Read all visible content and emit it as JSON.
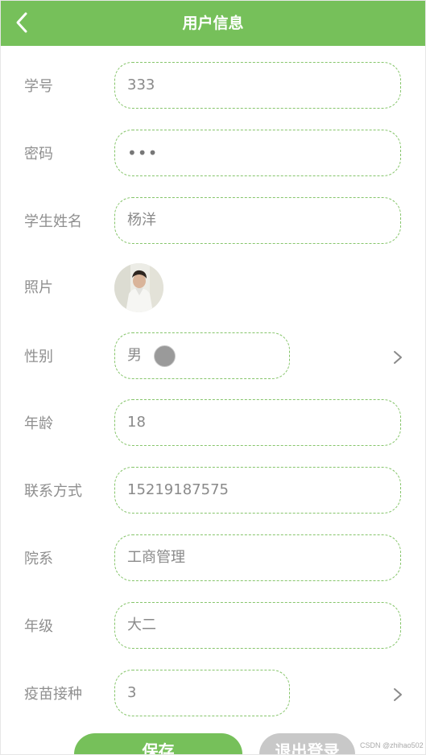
{
  "header": {
    "title": "用户信息",
    "back_icon": "chevron-left-icon",
    "background": "#76c05a"
  },
  "form": {
    "student_id": {
      "label": "学号",
      "value": "333"
    },
    "password": {
      "label": "密码",
      "value": "•••"
    },
    "student_name": {
      "label": "学生姓名",
      "value": "杨洋"
    },
    "photo": {
      "label": "照片",
      "image": "profile-photo"
    },
    "gender": {
      "label": "性别",
      "value": "男",
      "selected": false
    },
    "age": {
      "label": "年龄",
      "value": "18"
    },
    "contact": {
      "label": "联系方式",
      "value": "15219187575"
    },
    "department": {
      "label": "院系",
      "value": "工商管理"
    },
    "grade": {
      "label": "年级",
      "value": "大二"
    },
    "vaccination": {
      "label": "疫苗接种",
      "value": "3"
    }
  },
  "actions": {
    "save_label": "保存",
    "logout_label": "退出登录"
  },
  "watermark": "CSDN @zhihao502",
  "colors": {
    "accent": "#76c05a",
    "field_border": "#86c56b",
    "logout": "#c8c8c8"
  }
}
